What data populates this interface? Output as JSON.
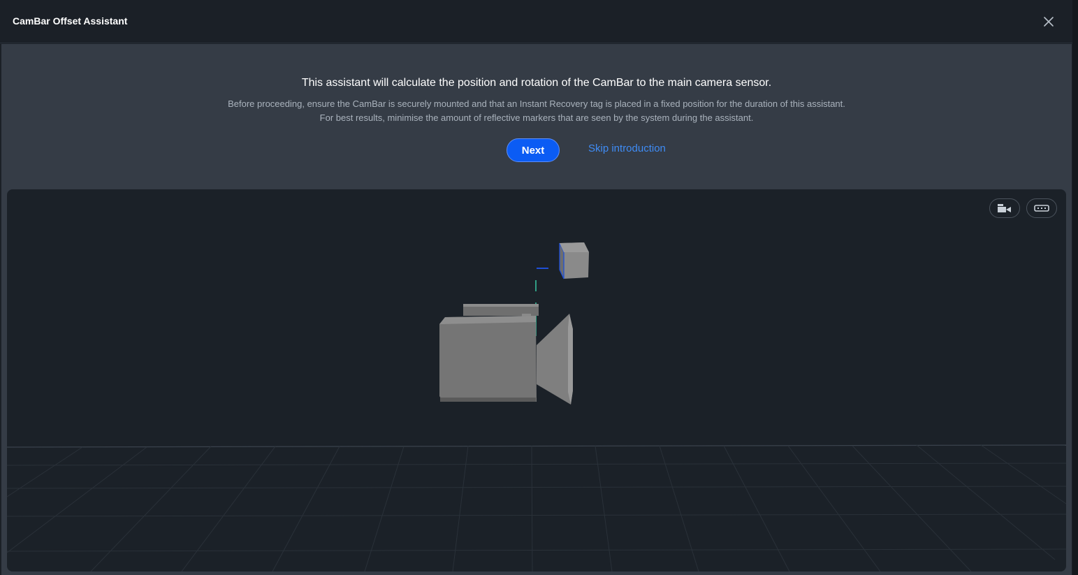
{
  "window": {
    "title": "CamBar Offset Assistant",
    "close_icon": "close-icon"
  },
  "intro": {
    "headline": "This assistant will calculate the position and rotation of the CamBar to the main camera sensor.",
    "description_line1": "Before proceeding, ensure the CamBar is securely mounted and that an Instant Recovery tag is placed in a fixed position for the duration of this assistant.",
    "description_line2": "For best results, minimise the amount of reflective markers that are seen by the system during the assistant.",
    "next_label": "Next",
    "skip_label": "Skip introduction"
  },
  "viewport": {
    "buttons": [
      {
        "icon": "camera-view-icon"
      },
      {
        "icon": "cambar-view-icon"
      }
    ],
    "colors": {
      "background": "#1b2128",
      "grid": "#2d343d",
      "camera_body": "#7a7a7a",
      "axis_blue": "#1f4fd6",
      "axis_green": "#38c9a3"
    }
  },
  "colors": {
    "accent": "#0b5cf4",
    "link": "#3f8cf5",
    "panel": "#353c46",
    "titlebar": "#1b2027"
  }
}
